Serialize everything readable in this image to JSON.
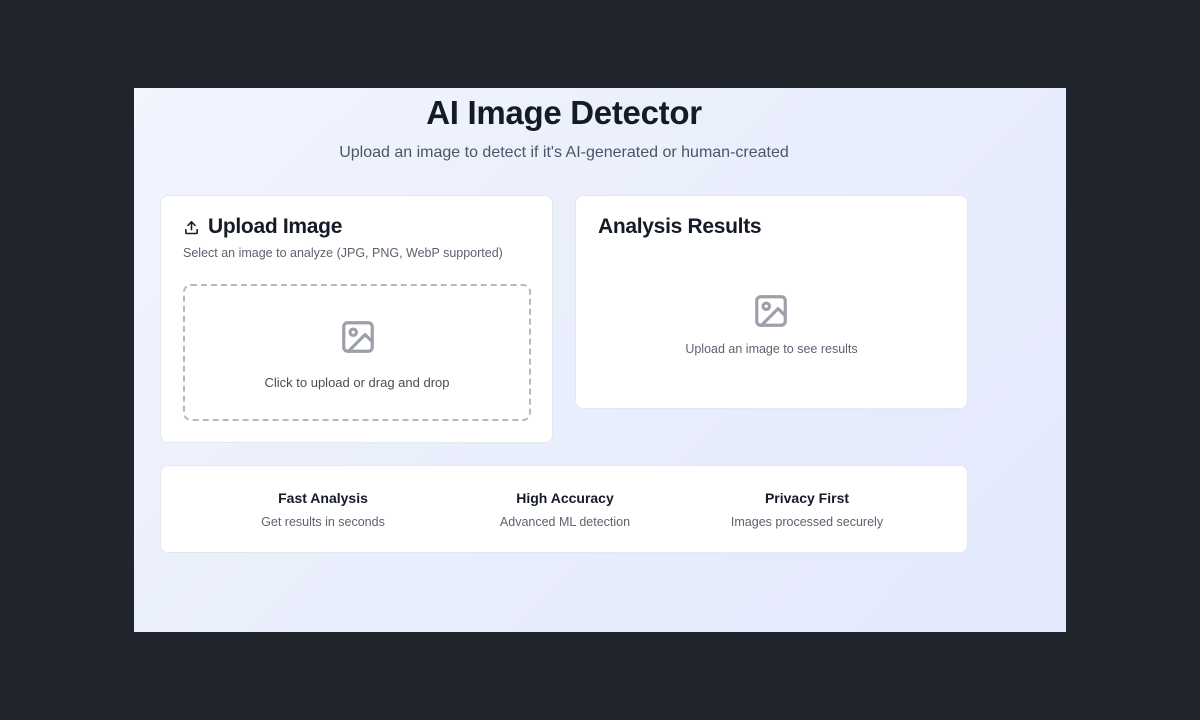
{
  "header": {
    "title": "AI Image Detector",
    "subtitle": "Upload an image to detect if it's AI-generated or human-created"
  },
  "upload": {
    "title": "Upload Image",
    "title_icon": "upload-icon",
    "description": "Select an image to analyze (JPG, PNG, WebP supported)",
    "dropzone_icon": "image-icon",
    "dropzone_text": "Click to upload or drag and drop"
  },
  "results": {
    "title": "Analysis Results",
    "empty_icon": "image-icon",
    "empty_text": "Upload an image to see results"
  },
  "features": [
    {
      "title": "Fast Analysis",
      "description": "Get results in seconds"
    },
    {
      "title": "High Accuracy",
      "description": "Advanced ML detection"
    },
    {
      "title": "Privacy First",
      "description": "Images processed securely"
    }
  ],
  "colors": {
    "outer_background": "#20242d",
    "text_primary": "#141a26",
    "text_muted": "#5b6270",
    "icon_gray": "#9ca0a8"
  }
}
